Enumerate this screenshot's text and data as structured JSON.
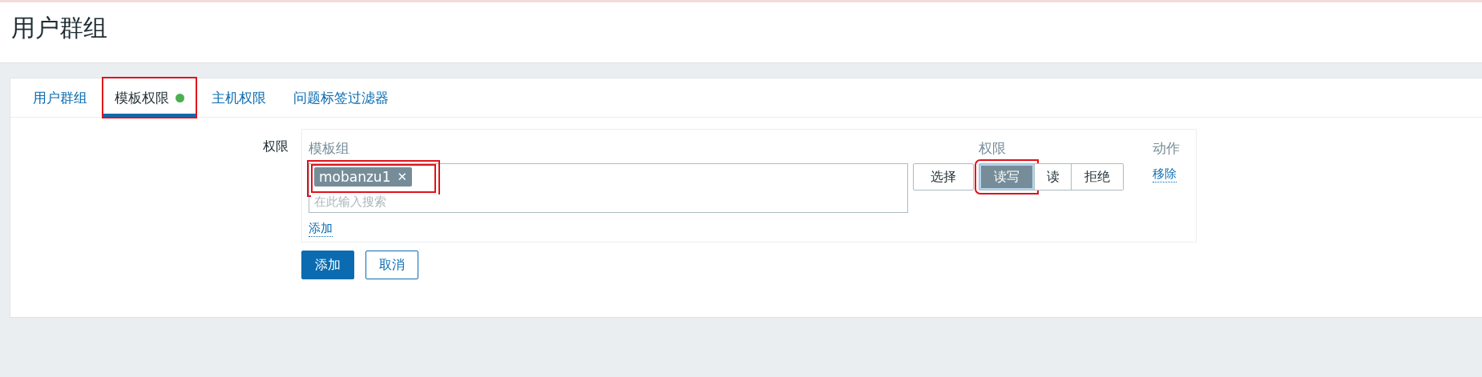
{
  "page": {
    "title": "用户群组"
  },
  "tabs": [
    {
      "label": "用户群组",
      "selected": false,
      "highlighted": false,
      "indicator": false
    },
    {
      "label": "模板权限",
      "selected": true,
      "highlighted": true,
      "indicator": true
    },
    {
      "label": "主机权限",
      "selected": false,
      "highlighted": false,
      "indicator": false
    },
    {
      "label": "问题标签过滤器",
      "selected": false,
      "highlighted": false,
      "indicator": false
    }
  ],
  "form": {
    "label": "权限",
    "columns": [
      "模板组",
      "权限",
      "动作"
    ],
    "rows": [
      {
        "tags": [
          {
            "label": "mobanzu1",
            "remove": "✕",
            "highlighted": true
          }
        ],
        "placeholder": "在此输入搜索",
        "select_button": "选择",
        "options": [
          {
            "label": "读写",
            "selected": true,
            "highlighted": true
          },
          {
            "label": "读",
            "selected": false,
            "highlighted": false
          },
          {
            "label": "拒绝",
            "selected": false,
            "highlighted": false
          }
        ],
        "action": "移除"
      }
    ],
    "add_link": "添加"
  },
  "buttons": [
    {
      "label": "添加",
      "kind": "primary"
    },
    {
      "label": "取消",
      "kind": "secondary"
    }
  ]
}
